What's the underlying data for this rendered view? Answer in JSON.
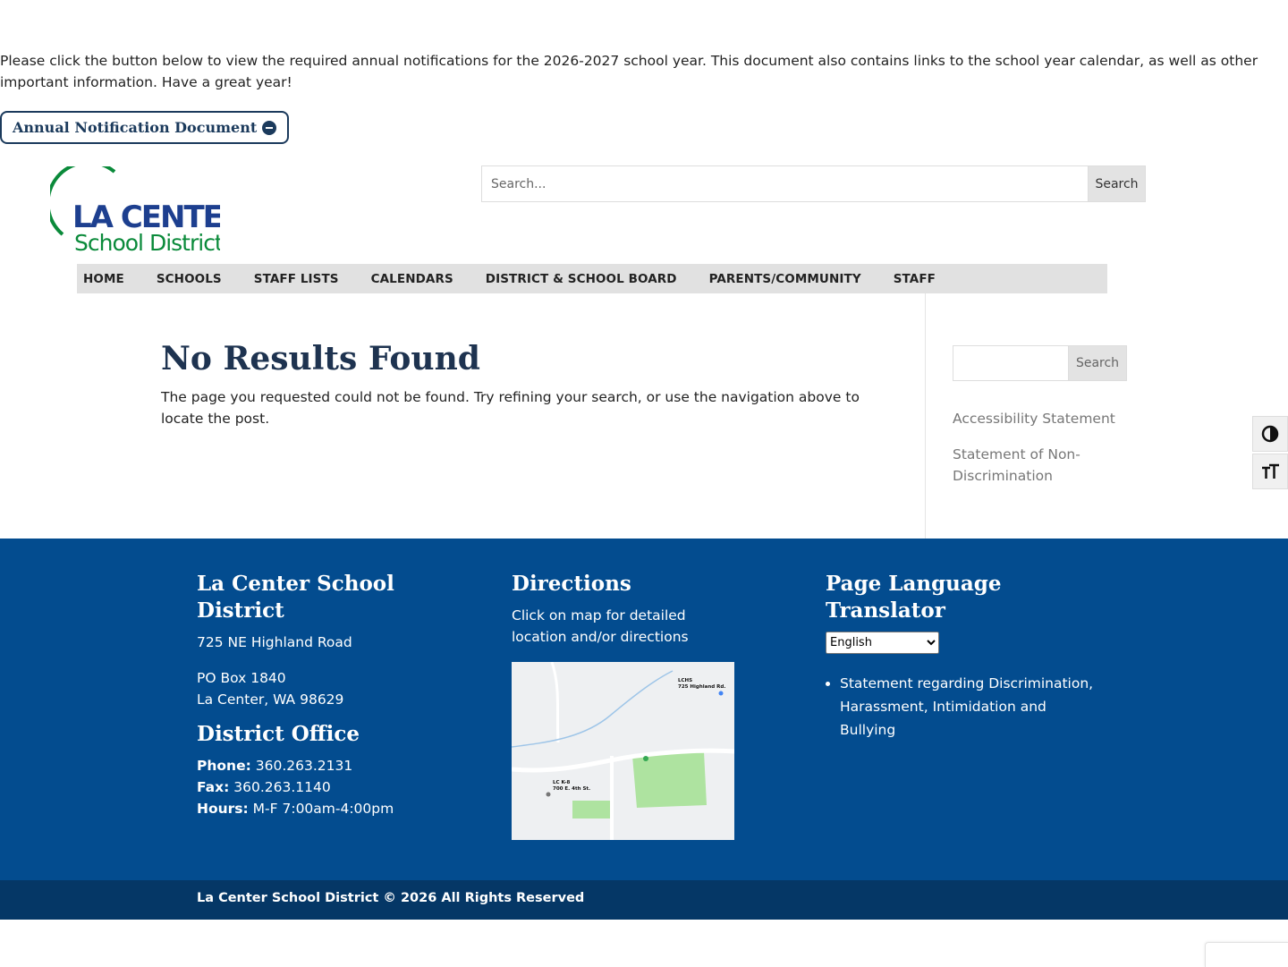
{
  "notice": {
    "text": "Please click the button below to view the required  annual notifications for the 2026-2027 school year. This document also contains links to the school year calendar, as well as other important information.  Have a great year!",
    "button_label": "Annual Notification Document"
  },
  "logo": {
    "line1": "LA CENTER",
    "line2": "School District"
  },
  "header_search": {
    "placeholder": "Search...",
    "button": "Search"
  },
  "nav": {
    "items": [
      "HOME",
      "SCHOOLS",
      "STAFF LISTS",
      "CALENDARS",
      "DISTRICT & SCHOOL BOARD",
      "PARENTS/COMMUNITY",
      "STAFF"
    ]
  },
  "main": {
    "title": "No Results Found",
    "message": "The page you requested could not be found. Try refining your search, or use the navigation above to locate the post."
  },
  "sidebar": {
    "search_button": "Search",
    "links": [
      "Accessibility Statement",
      "Statement of Non-Discrimination"
    ]
  },
  "footer": {
    "district": {
      "title": "La Center School District",
      "address": "725 NE Highland Road",
      "po_box": "PO Box 1840",
      "city": "La Center, WA 98629",
      "office_title": "District Office",
      "phone_label": "Phone:",
      "phone": "360.263.2131",
      "fax_label": "Fax:",
      "fax": "360.263.1140",
      "hours_label": "Hours:",
      "hours": "M-F 7:00am-4:00pm"
    },
    "directions": {
      "title": "Directions",
      "text": "Click on map for detailed location and/or directions",
      "map_labels": {
        "lchs": "LCHS",
        "lchs_addr": "725 Highland Rd.",
        "lck8": "LC K-8",
        "lck8_addr": "700 E. 4th St."
      }
    },
    "translator": {
      "title": "Page Language Translator",
      "selected_language": "English",
      "links": [
        "Statement regarding Discrimination, Harassment, Intimidation and Bullying"
      ]
    },
    "copyright": "La Center School District © 2026 All Rights Reserved"
  },
  "colors": {
    "footer_bg": "#034c8f",
    "bottom_bar_bg": "#053766",
    "nav_bg": "#e1e1e1",
    "title": "#1e3350",
    "logo_green": "#0a8a3a",
    "logo_blue": "#1d3f8f"
  }
}
